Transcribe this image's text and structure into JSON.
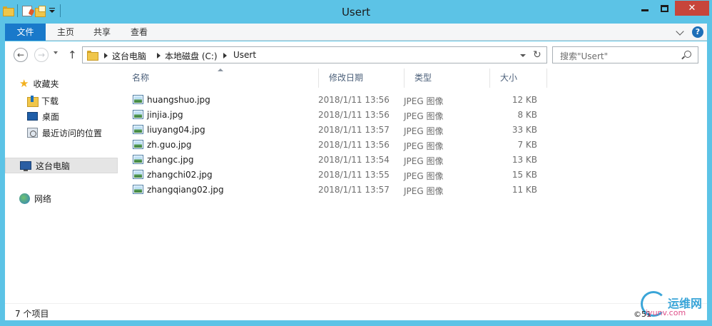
{
  "window": {
    "title": "Usert",
    "close_glyph": "✕"
  },
  "ribbon": {
    "tabs": [
      "文件",
      "主页",
      "共享",
      "查看"
    ],
    "help_glyph": "?"
  },
  "address": {
    "crumbs": [
      "这台电脑",
      "本地磁盘 (C:)",
      "Usert"
    ],
    "search_placeholder": "搜索\"Usert\""
  },
  "nav": {
    "favorites": "收藏夹",
    "downloads": "下载",
    "desktop": "桌面",
    "recent": "最近访问的位置",
    "this_pc": "这台电脑",
    "network": "网络"
  },
  "columns": [
    "名称",
    "修改日期",
    "类型",
    "大小"
  ],
  "files": [
    {
      "name": "huangshuo.jpg",
      "date": "2018/1/11 13:56",
      "type": "JPEG 图像",
      "size": "12 KB"
    },
    {
      "name": "jinjia.jpg",
      "date": "2018/1/11 13:56",
      "type": "JPEG 图像",
      "size": "8 KB"
    },
    {
      "name": "liuyang04.jpg",
      "date": "2018/1/11 13:57",
      "type": "JPEG 图像",
      "size": "33 KB"
    },
    {
      "name": "zh.guo.jpg",
      "date": "2018/1/11 13:56",
      "type": "JPEG 图像",
      "size": "7 KB"
    },
    {
      "name": "zhangc.jpg",
      "date": "2018/1/11 13:54",
      "type": "JPEG 图像",
      "size": "13 KB"
    },
    {
      "name": "zhangchi02.jpg",
      "date": "2018/1/11 13:55",
      "type": "JPEG 图像",
      "size": "15 KB"
    },
    {
      "name": "zhangqiang02.jpg",
      "date": "2018/1/11 13:57",
      "type": "JPEG 图像",
      "size": "11 KB"
    }
  ],
  "status": {
    "item_count": "7 个项目"
  },
  "watermark": {
    "cn": "运维网",
    "en": "iyunv.com",
    "c": "©51"
  }
}
